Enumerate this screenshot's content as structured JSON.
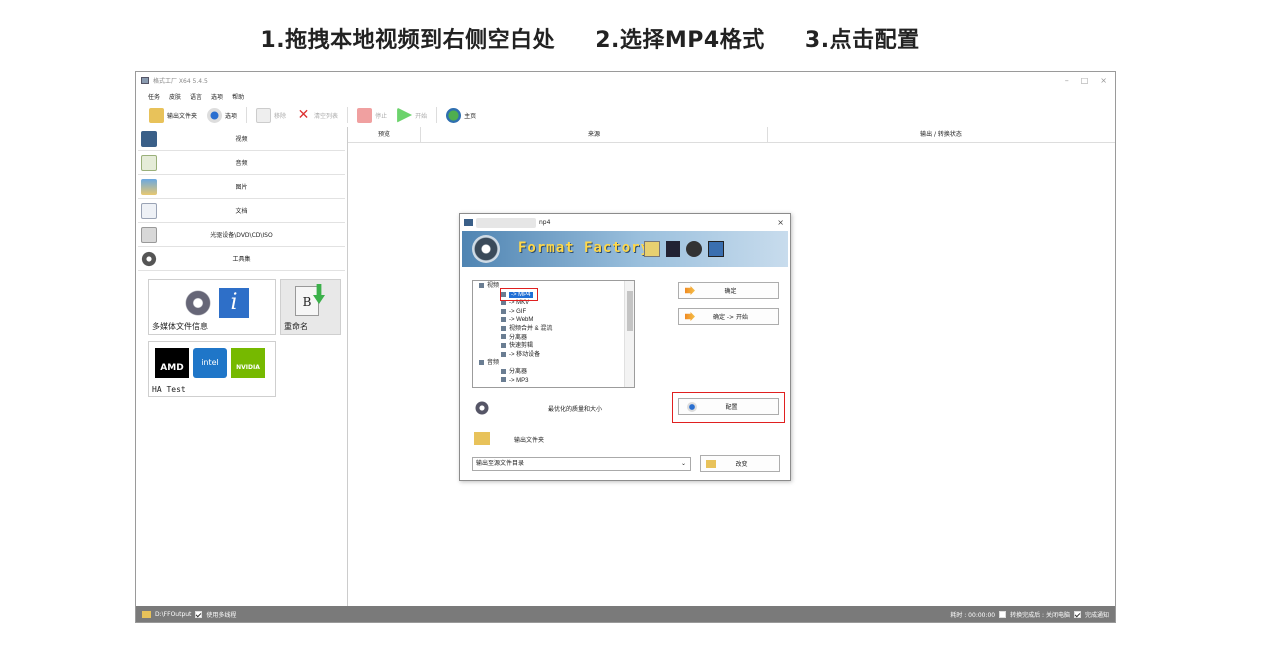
{
  "instructions": {
    "step1": "1.拖拽本地视频到右侧空白处",
    "step2": "2.选择MP4格式",
    "step3": "3.点击配置"
  },
  "window": {
    "title": "格式工厂 X64 5.4.5",
    "controls": [
      "–",
      "□",
      "×"
    ]
  },
  "menu": [
    "任务",
    "皮肤",
    "语言",
    "选项",
    "帮助"
  ],
  "toolbar": {
    "output_folder": "输出文件夹",
    "options": "选项",
    "remove": "移除",
    "clear_list": "清空列表",
    "stop": "停止",
    "start": "开始",
    "home": "主页"
  },
  "categories": [
    {
      "label": "视频",
      "icon": "film-icon",
      "color": "#3a5f88"
    },
    {
      "label": "音频",
      "icon": "music-note-icon",
      "color": "#6a8a6a"
    },
    {
      "label": "图片",
      "icon": "picture-icon",
      "color": "#4c88c8"
    },
    {
      "label": "文档",
      "icon": "document-icon",
      "color": "#7a7a9a"
    },
    {
      "label": "光驱设备\\DVD\\CD\\ISO",
      "icon": "disc-icon",
      "color": "#9a9a9a"
    },
    {
      "label": "工具集",
      "icon": "tools-reel-icon",
      "color": "#666666"
    }
  ],
  "tools": {
    "media_info": "多媒体文件信息",
    "rename": "重命名",
    "ha_test": "HA Test",
    "amd": "AMD",
    "intel": "intel",
    "nvidia": "NVIDIA"
  },
  "list_headers": [
    "预览",
    "来源",
    "输出 / 转换状态"
  ],
  "status": {
    "output_path": "D:\\FFOutput",
    "multithread": "使用多线程",
    "elapsed": "耗时 : 00:00:00",
    "after_convert": "转换完成后 : 关闭电脑",
    "notify": "完成通知"
  },
  "dialog": {
    "title_suffix": "np4",
    "close": "×",
    "banner_text": "Format Factory",
    "tree": [
      {
        "label": "视频",
        "level": 0,
        "prefix": "⊟"
      },
      {
        "label": "-> MP4",
        "level": 1,
        "selected": true
      },
      {
        "label": "-> MKV",
        "level": 1
      },
      {
        "label": "-> GIF",
        "level": 1
      },
      {
        "label": "-> WebM",
        "level": 1
      },
      {
        "label": "视频合并 & 混流",
        "level": 1
      },
      {
        "label": "分离器",
        "level": 1
      },
      {
        "label": "快速剪辑",
        "level": 1
      },
      {
        "label": "-> 移动设备",
        "level": 1
      },
      {
        "label": "音频",
        "level": 0,
        "prefix": "⊟"
      },
      {
        "label": "分离器",
        "level": 1
      },
      {
        "label": "-> MP3",
        "level": 1
      }
    ],
    "ok": "确定",
    "ok_start": "确定 -> 开始",
    "quality": "最优化的质量和大小",
    "configure": "配置",
    "output_folder": "输出文件夹",
    "output_select": "输出至源文件目录",
    "change": "改变"
  }
}
